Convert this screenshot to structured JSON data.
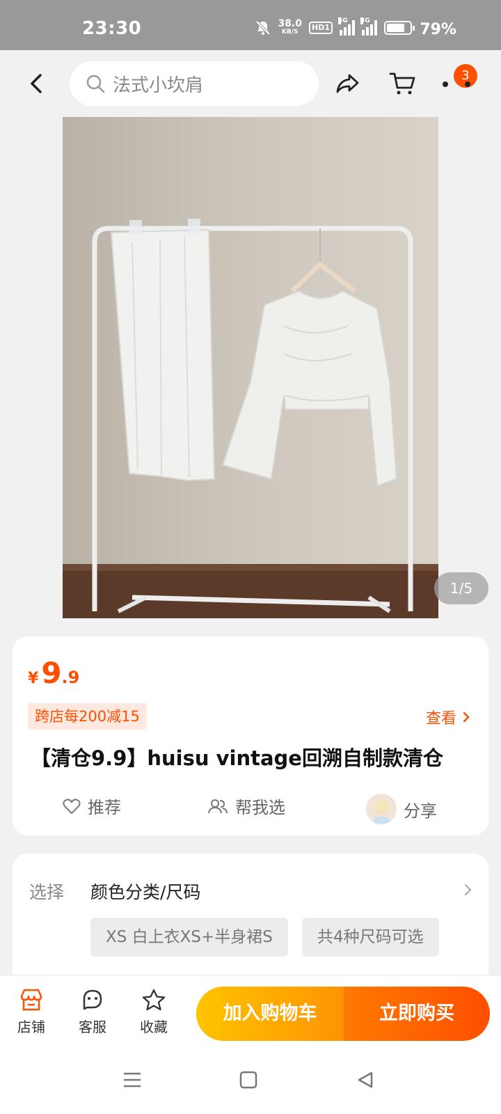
{
  "status_bar": {
    "time": "23:30",
    "net_speed_value": "38.0",
    "net_speed_unit": "KB/S",
    "hd_label": "HD1",
    "signal1_label": "5G",
    "signal2_label": "3G",
    "battery_percent": "79%",
    "battery_level": 0.79
  },
  "top_nav": {
    "search_placeholder": "法式小坎肩",
    "cart_badge": "3"
  },
  "gallery": {
    "counter": "1/5"
  },
  "product": {
    "currency": "¥",
    "price_int": "9",
    "price_dec": ".9",
    "promo_tag": "跨店每200减15",
    "view_label": "查看",
    "title": "【清仓9.9】huisu vintage回溯自制款清仓",
    "recommend_label": "推荐",
    "help_choose_label": "帮我选",
    "share_label": "分享"
  },
  "spec": {
    "select_label": "选择",
    "select_value": "颜色分类/尺码",
    "chip1": "XS 白上衣XS+半身裙S",
    "chip2": "共4种尺码可选"
  },
  "bottom_bar": {
    "shop_label": "店铺",
    "service_label": "客服",
    "favorite_label": "收藏",
    "add_cart_label": "加入购物车",
    "buy_now_label": "立即购买"
  },
  "colors": {
    "accent": "#ff5000",
    "cart_button": "#ffb000",
    "buy_button": "#ff5a00"
  }
}
